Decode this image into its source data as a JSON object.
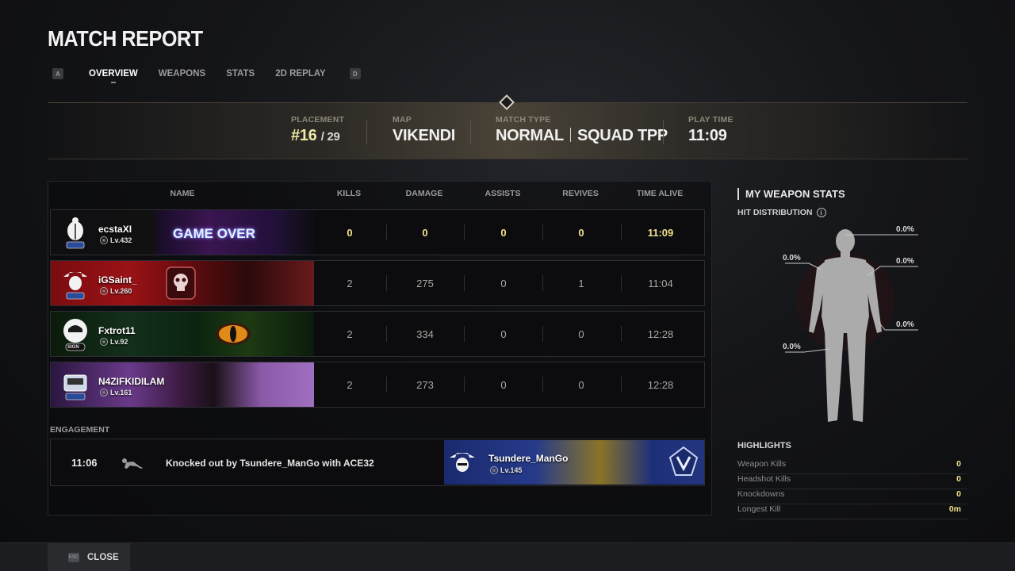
{
  "header": {
    "title": "MATCH REPORT",
    "tabs": [
      "OVERVIEW",
      "WEAPONS",
      "STATS",
      "2D REPLAY"
    ],
    "active_tab": "OVERVIEW",
    "prev_key": "A",
    "next_key": "D"
  },
  "match": {
    "placement_label": "PLACEMENT",
    "placement_rank": "#16",
    "placement_total": "/ 29",
    "map_label": "MAP",
    "map_value": "VIKENDI",
    "mode_label": "MATCH TYPE",
    "mode_type": "NORMAL",
    "mode_squad": "SQUAD TPP",
    "playtime_label": "PLAY TIME",
    "playtime_value": "11:09"
  },
  "table": {
    "headers": {
      "name": "NAME",
      "kills": "KILLS",
      "damage": "DAMAGE",
      "assists": "ASSISTS",
      "revives": "REVIVES",
      "time_alive": "TIME ALIVE"
    },
    "players": [
      {
        "name": "ecstaXI",
        "level": "Lv.432",
        "kills": "0",
        "damage": "0",
        "assists": "0",
        "revives": "0",
        "time_alive": "11:09",
        "banner_text": "GAME OVER"
      },
      {
        "name": "iGSaint_",
        "level": "Lv.260",
        "kills": "2",
        "damage": "275",
        "assists": "0",
        "revives": "1",
        "time_alive": "11:04"
      },
      {
        "name": "Fxtrot11",
        "level": "Lv.92",
        "kills": "2",
        "damage": "334",
        "assists": "0",
        "revives": "0",
        "time_alive": "12:28",
        "emblem_text": "SIGN"
      },
      {
        "name": "N4ZIFKIDILAM",
        "level": "Lv.161",
        "kills": "2",
        "damage": "273",
        "assists": "0",
        "revives": "0",
        "time_alive": "12:28"
      }
    ]
  },
  "engagement": {
    "label": "ENGAGEMENT",
    "time": "11:06",
    "text": "Knocked out by Tsundere_ManGo with ACE32",
    "enemy_name": "Tsundere_ManGo",
    "enemy_level": "Lv.145"
  },
  "weapon_stats": {
    "title": "MY WEAPON STATS",
    "hit_label": "HIT DISTRIBUTION",
    "head": "0.0%",
    "chest": "0.0%",
    "left_arm": "0.0%",
    "right_arm": "0.0%",
    "legs": "0.0%"
  },
  "highlights": {
    "title": "HIGHLIGHTS",
    "items": [
      {
        "label": "Weapon Kills",
        "value": "0"
      },
      {
        "label": "Headshot Kills",
        "value": "0"
      },
      {
        "label": "Knockdowns",
        "value": "0"
      },
      {
        "label": "Longest Kill",
        "value": "0m"
      }
    ]
  },
  "footer": {
    "esc_key": "ESC",
    "close_label": "CLOSE"
  },
  "colors": {
    "accent_yellow": "#eee08a",
    "placement_rank": "#efe7a6"
  }
}
